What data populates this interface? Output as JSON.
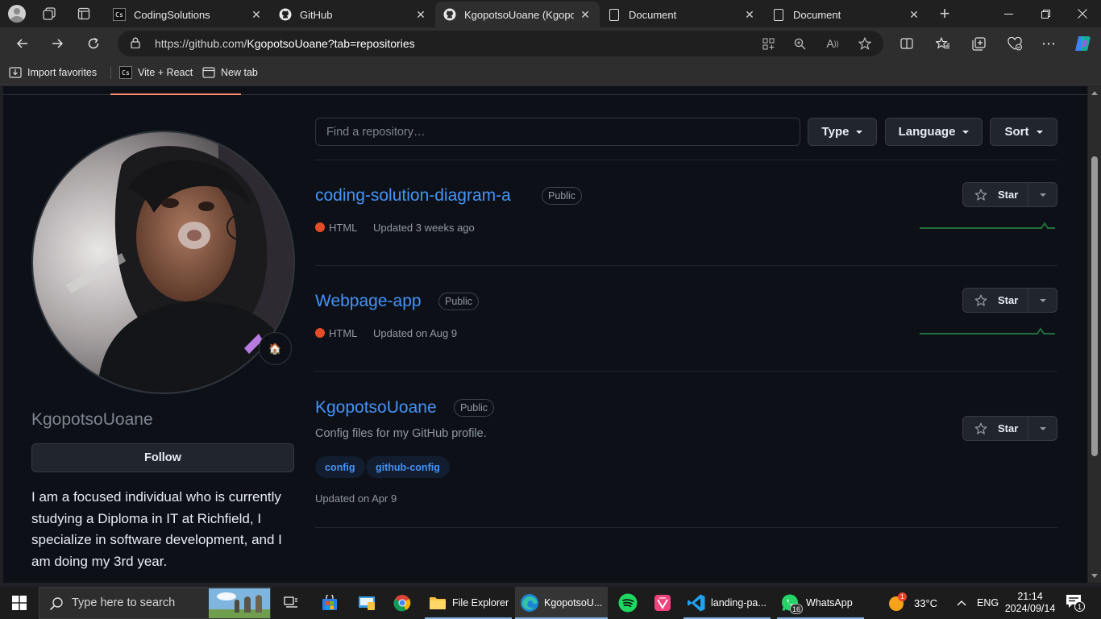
{
  "browser": {
    "tabs": [
      {
        "title": "CodingSolutions",
        "favicon": "cs-favicon"
      },
      {
        "title": "GitHub",
        "favicon": "github-favicon"
      },
      {
        "title": "KgopotsoUoane (Kgopotso",
        "favicon": "github-favicon",
        "active": true
      },
      {
        "title": "Document",
        "favicon": "document-favicon"
      },
      {
        "title": "Document",
        "favicon": "document-favicon"
      }
    ],
    "new_tab_symbol": "+",
    "url_prefix": "https://github.com/",
    "url_rest": "KgopotsoUoane?tab=repositories",
    "favorites": [
      {
        "label": "Import favorites",
        "icon": "import-icon"
      },
      {
        "label": "Vite + React",
        "icon": "cs-favicon"
      },
      {
        "label": "New tab",
        "icon": "new-tab-icon"
      }
    ]
  },
  "profile": {
    "username": "KgopotsoUoane",
    "follow_label": "Follow",
    "status_emoji": "🏠",
    "bio": "I am a focused individual who is currently studying a Diploma in IT at Richfield, I specialize in software development, and I am doing my 3rd year."
  },
  "repo_filters": {
    "search_placeholder": "Find a repository…",
    "type_label": "Type",
    "language_label": "Language",
    "sort_label": "Sort"
  },
  "repositories": [
    {
      "name": "coding-solution-diagram-a",
      "visibility": "Public",
      "language": "HTML",
      "language_color": "#e34c26",
      "updated": "Updated 3 weeks ago",
      "star_label": "Star"
    },
    {
      "name": "Webpage-app",
      "visibility": "Public",
      "language": "HTML",
      "language_color": "#e34c26",
      "updated": "Updated on Aug 9",
      "star_label": "Star"
    },
    {
      "name": "KgopotsoUoane",
      "visibility": "Public",
      "description": "Config files for my GitHub profile.",
      "topics": [
        "config",
        "github-config"
      ],
      "updated": "Updated on Apr 9",
      "star_label": "Star"
    }
  ],
  "taskbar": {
    "search_placeholder": "Type here to search",
    "apps": [
      {
        "label": "File Explorer"
      },
      {
        "label": "KgopotsoU..."
      },
      {
        "label": "landing-pa..."
      },
      {
        "label": "WhatsApp",
        "badge": "16"
      }
    ],
    "weather_badge": "1",
    "temperature": "33°C",
    "language": "ENG",
    "time": "21:14",
    "date": "2024/09/14",
    "notification_count": "1"
  }
}
